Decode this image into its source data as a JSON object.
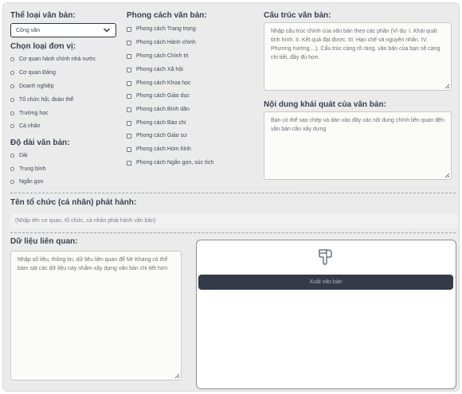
{
  "left": {
    "doc_type_label": "Thể loại văn bản:",
    "doc_type_selected": "Công văn",
    "unit_label": "Chọn loại đơn vị:",
    "units": [
      "Cơ quan hành chính nhà nước",
      "Cơ quan Đảng",
      "Doanh nghiệp",
      "Tổ chức hội, đoàn thể",
      "Trường học",
      "Cá nhân"
    ],
    "length_label": "Độ dài văn bản:",
    "lengths": [
      "Dài",
      "Trung bình",
      "Ngắn gọn"
    ]
  },
  "styles": {
    "label": "Phong cách văn bản:",
    "items": [
      "Phong cách Trang trọng",
      "Phong cách Hành chính",
      "Phong cách Chính trị",
      "Phong cách Xã hội",
      "Phong cách Khoa học",
      "Phong cách Giáo dục",
      "Phong cách Bình dân",
      "Phong cách Báo chí",
      "Phong cách Giáo sư",
      "Phong cách Hóm hỉnh",
      "Phong cách Ngắn gọn, súc tích"
    ]
  },
  "structure": {
    "label": "Cấu trúc văn bản:",
    "placeholder": "Nhập cấu trúc chính của văn bản theo các phần (Ví dụ: I. Khái quát tình hình. II. Kết quả đạt được. III. Hạn chế và nguyên nhân. IV. Phương hướng....). Cấu trúc càng rõ ràng, văn bản của bạn sẽ càng chi tiết, đầy đủ hơn."
  },
  "summary": {
    "label": "Nội dung khái quát của văn bản:",
    "placeholder": "Bạn có thể sao chép và dán vào đây các nội dung chính liên quan đến văn bản cần xây dựng"
  },
  "issuer": {
    "label": "Tên tổ chức (cá nhân) phát hành:",
    "placeholder": "(Nhập tên cơ quan, tổ chức, cá nhân phát hành văn bản)"
  },
  "related": {
    "label": "Dữ liệu liên quan:",
    "placeholder": "Nhập số liệu, thông tin, dữ liệu liên quan để Mr Khang có thể bám sát các dữ liệu này nhằm xây dựng văn bản chi tiết hơn"
  },
  "output": {
    "export_label": "Xuất văn bản",
    "icon": "pointing-hand-icon"
  }
}
